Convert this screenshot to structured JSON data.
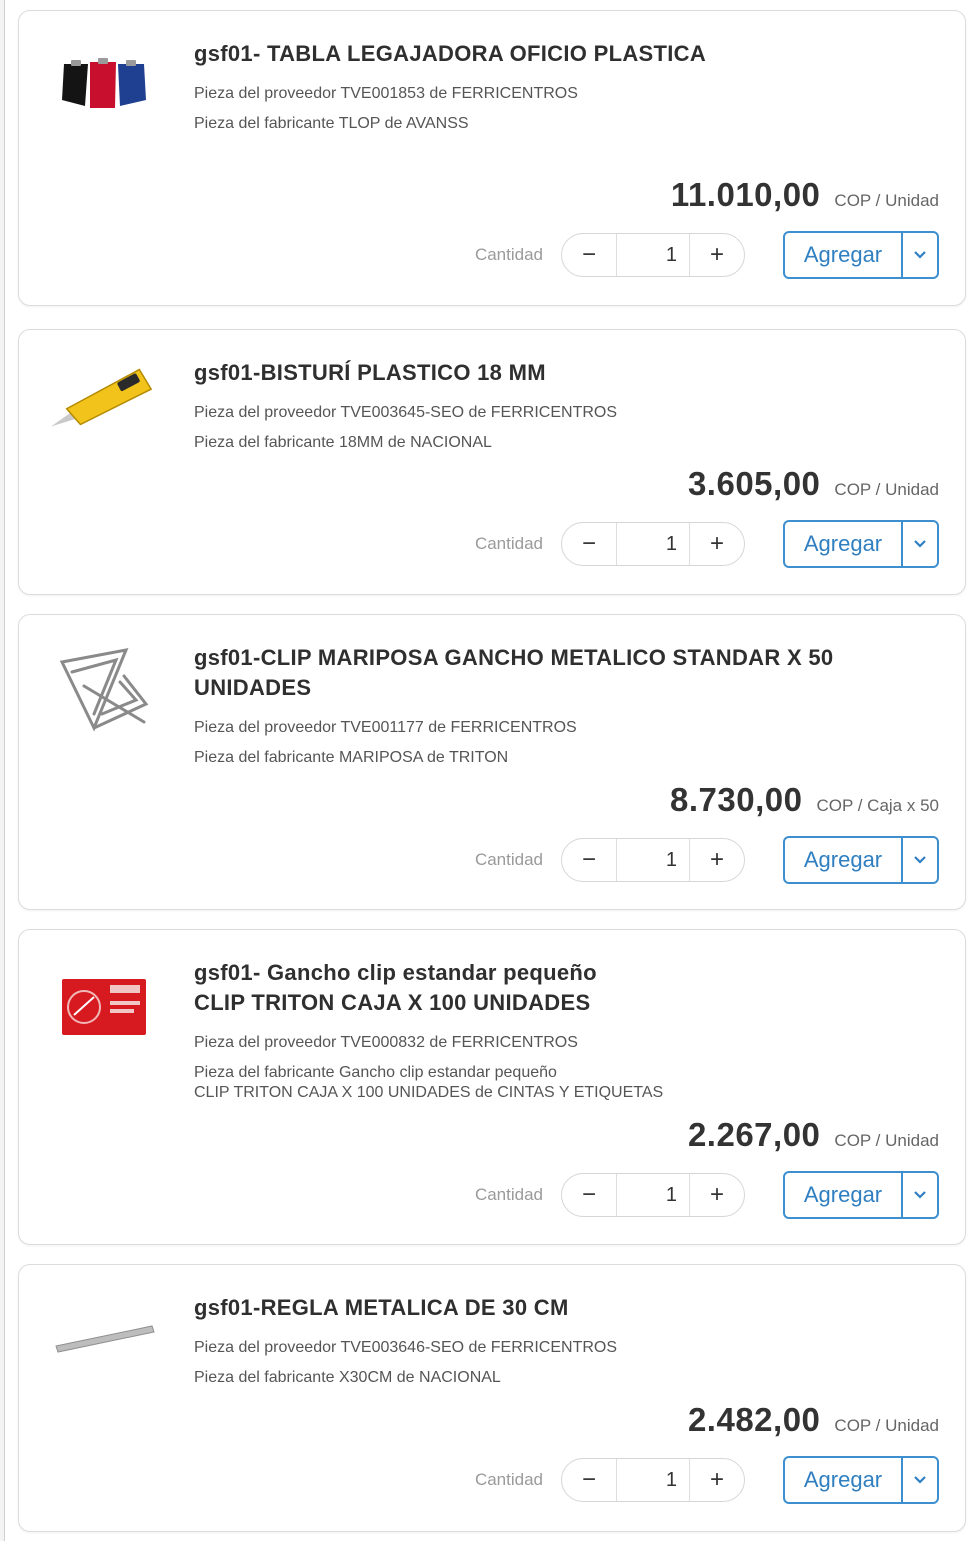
{
  "common": {
    "qty_label": "Cantidad",
    "minus": "−",
    "plus": "+",
    "add_label": "Agregar",
    "accent_color": "#3d8fcf"
  },
  "products": [
    {
      "title": "gsf01- TABLA LEGAJADORA OFICIO PLASTICA",
      "supplier": "Pieza del proveedor TVE001853 de FERRICENTROS",
      "maker": "Pieza del fabricante TLOP de AVANSS",
      "price": "11.010,00",
      "unit": "COP / Unidad",
      "qty": "1",
      "icon": "clipboards-icon"
    },
    {
      "title": "gsf01-BISTURÍ PLASTICO 18 MM",
      "supplier": "Pieza del proveedor TVE003645-SEO de FERRICENTROS",
      "maker": "Pieza del fabricante 18MM de NACIONAL",
      "price": "3.605,00",
      "unit": "COP / Unidad",
      "qty": "1",
      "icon": "cutter-icon"
    },
    {
      "title": "gsf01-CLIP MARIPOSA GANCHO METALICO STANDAR X 50\nUNIDADES",
      "supplier": "Pieza del proveedor TVE001177 de FERRICENTROS",
      "maker": "Pieza del fabricante MARIPOSA de TRITON",
      "price": "8.730,00",
      "unit": "COP / Caja x 50",
      "qty": "1",
      "icon": "butterfly-clip-icon"
    },
    {
      "title": "gsf01- Gancho clip estandar pequeño\nCLIP TRITON CAJA X 100 UNIDADES",
      "supplier": "Pieza del proveedor TVE000832 de FERRICENTROS",
      "maker": "Pieza del fabricante Gancho clip estandar pequeño\nCLIP TRITON CAJA X 100 UNIDADES de CINTAS Y ETIQUETAS",
      "price": "2.267,00",
      "unit": "COP / Unidad",
      "qty": "1",
      "icon": "clip-box-icon"
    },
    {
      "title": "gsf01-REGLA METALICA DE 30 CM",
      "supplier": "Pieza del proveedor TVE003646-SEO de FERRICENTROS",
      "maker": "Pieza del fabricante X30CM de NACIONAL",
      "price": "2.482,00",
      "unit": "COP / Unidad",
      "qty": "1",
      "icon": "ruler-icon"
    }
  ]
}
